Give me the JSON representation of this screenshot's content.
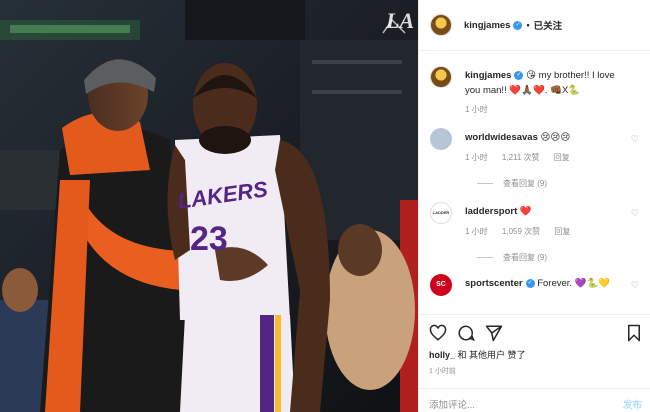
{
  "post": {
    "username": "kingjames",
    "follow_label": "已关注",
    "caption_username": "kingjames",
    "caption_text": "😘 my brother!! I love you man!! ❤️🙏🏾❤️. 👊🏾X🐍",
    "caption_time": "1 小时"
  },
  "comments": [
    {
      "username": "worldwidesavas",
      "text": "😢😢😢",
      "time": "1 小时",
      "likes": "1,211 次赞",
      "reply": "回复",
      "view_replies": "查看回复 (9)",
      "avatar_color": "#b7c6d6"
    },
    {
      "username": "laddersport",
      "text": "❤️",
      "time": "1 小时",
      "likes": "1,059 次赞",
      "reply": "回复",
      "view_replies": "查看回复 (9)",
      "avatar_label": "LADDER",
      "avatar_color": "#ffffff"
    },
    {
      "username": "sportscenter",
      "text": "Forever. 💜🐍💛",
      "avatar_label": "SC",
      "avatar_color": "#d0021b"
    }
  ],
  "footer": {
    "liked_by_user": "holly_",
    "liked_by_rest": " 和 其他用户 赞了",
    "time_ago": "1 小时前",
    "comment_placeholder": "添加评论...",
    "post_label": "发布"
  },
  "media": {
    "watermark": "LA",
    "jersey_text": "LAKERS",
    "jersey_number": "23"
  },
  "colors": {
    "verified": "#3897f0",
    "heart": "#ed4956",
    "link_disabled": "#b2dffc",
    "muted": "#8e8e8e"
  }
}
